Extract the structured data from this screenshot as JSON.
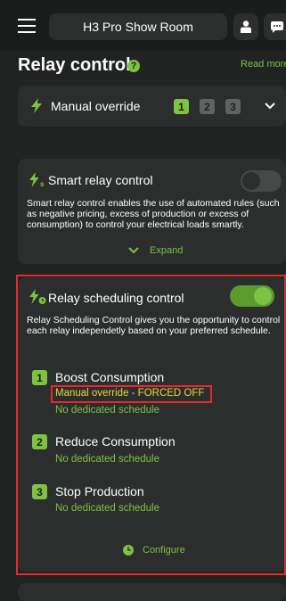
{
  "header": {
    "menu_icon": "hamburger-menu-icon",
    "title": "H3 Pro Show Room",
    "user_icon": "user-icon",
    "chat_icon": "chat-bubble-icon"
  },
  "page": {
    "title": "Relay control",
    "help_icon": "question-icon",
    "read_more": "Read more"
  },
  "manual_override": {
    "icon": "lightning-icon",
    "label": "Manual override",
    "relays": [
      "1",
      "2",
      "3"
    ],
    "active_relay": "1",
    "chevron_icon": "chevron-down-icon"
  },
  "smart_relay": {
    "icon": "lightning-s-icon",
    "title": "Smart relay control",
    "enabled": false,
    "description": "Smart relay control enables the use of automated rules (such as negative pricing, excess of production or excess of consumption) to control your electrical loads smartly.",
    "expand_label": "Expand",
    "expand_icon": "chevron-down-icon"
  },
  "scheduling": {
    "icon": "lightning-clock-icon",
    "title": "Relay scheduling control",
    "enabled": true,
    "description": "Relay Scheduling Control gives you the opportunity to control each relay independetly based on your preferred schedule.",
    "relays": [
      {
        "number": "1",
        "name": "Boost Consumption",
        "override": "Manual override - FORCED OFF",
        "schedule": "No dedicated schedule"
      },
      {
        "number": "2",
        "name": "Reduce Consumption",
        "schedule": "No dedicated schedule"
      },
      {
        "number": "3",
        "name": "Stop Production",
        "schedule": "No dedicated schedule"
      }
    ],
    "configure_label": "Configure",
    "configure_icon": "clock-icon"
  },
  "colors": {
    "accent": "#7dc242",
    "warning": "#e8d53a",
    "highlight_border": "#e52a2a",
    "background": "#202322",
    "card": "#2b2e2d"
  }
}
